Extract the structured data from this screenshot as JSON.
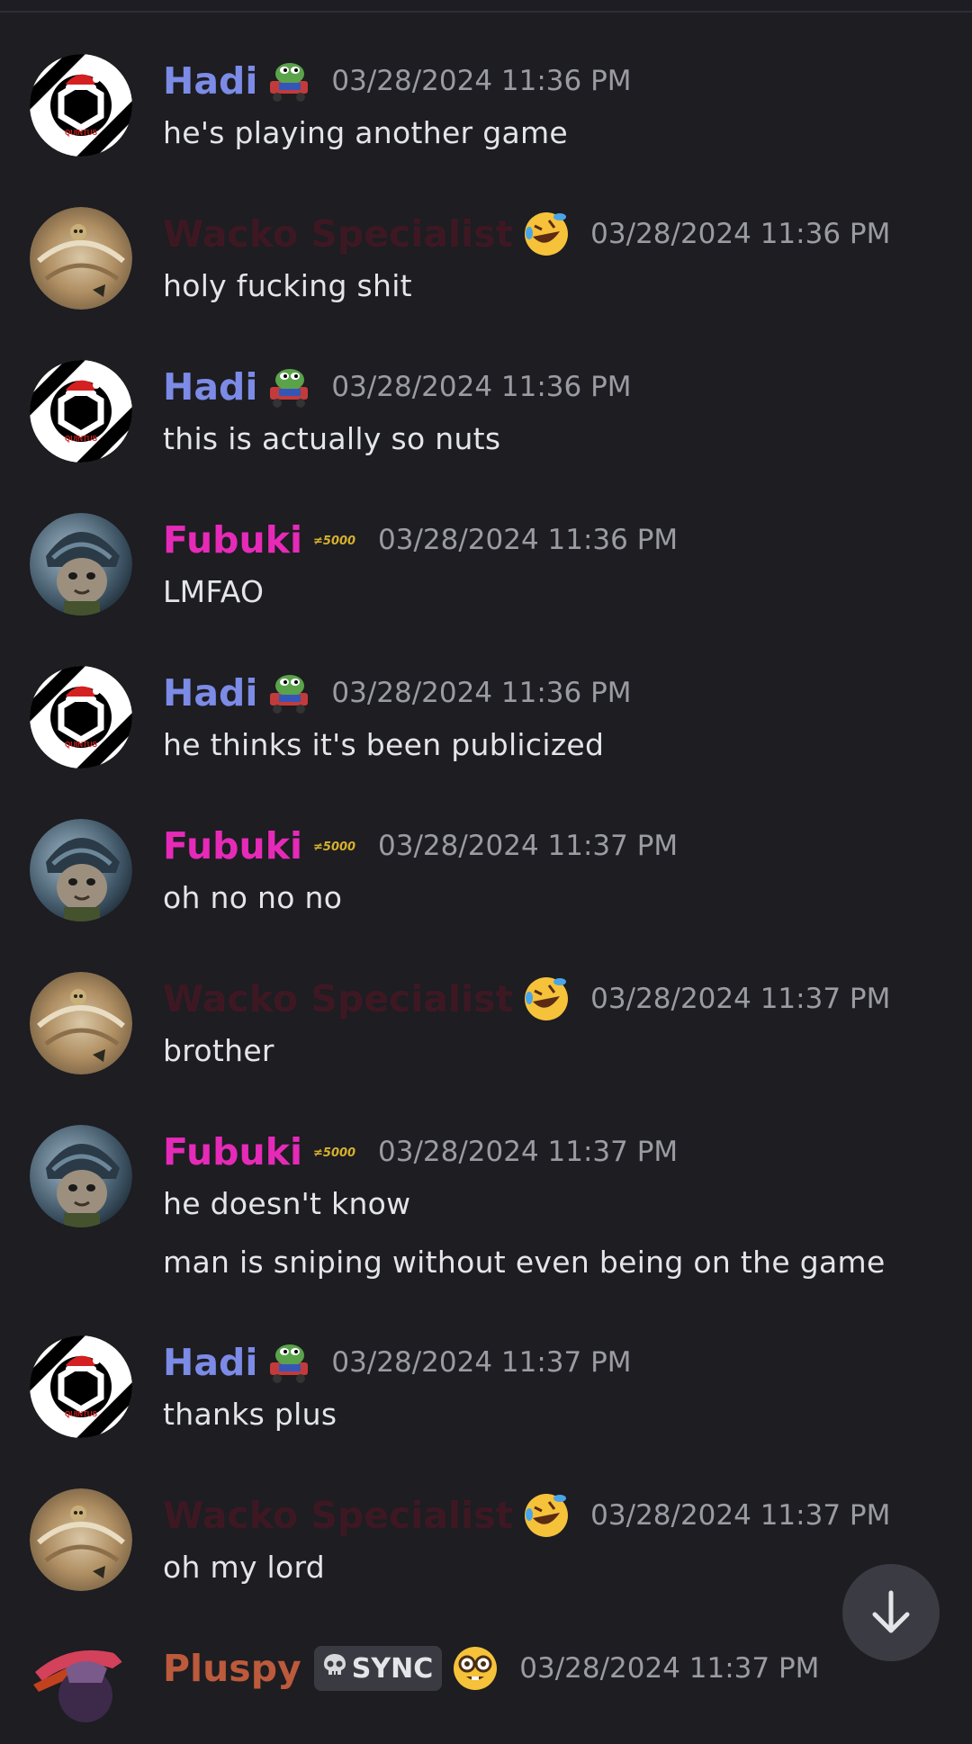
{
  "colors": {
    "background": "#1d1d22",
    "hadi": "#7c8be6",
    "fubuki": "#e62ab8",
    "wacko": "#3d1822",
    "pluspy": "#bc5a3b",
    "timestamp": "#9b9ca3",
    "text": "#e4e5e8"
  },
  "messages": [
    {
      "author": "Hadi",
      "badge": "pepe-cart-emoji",
      "timestamp": "03/28/2024 11:36 PM",
      "lines": [
        "he's playing another game"
      ]
    },
    {
      "author": "Wacko Specialist",
      "badge": "rofl-emoji",
      "timestamp": "03/28/2024 11:36 PM",
      "lines": [
        "holy fucking shit"
      ]
    },
    {
      "author": "Hadi",
      "badge": "pepe-cart-emoji",
      "timestamp": "03/28/2024 11:36 PM",
      "lines": [
        "this is actually so nuts"
      ]
    },
    {
      "author": "Fubuki",
      "badge": "gold-5000-badge",
      "timestamp": "03/28/2024 11:36 PM",
      "lines": [
        "LMFAO"
      ]
    },
    {
      "author": "Hadi",
      "badge": "pepe-cart-emoji",
      "timestamp": "03/28/2024 11:36 PM",
      "lines": [
        "he thinks it's been publicized"
      ]
    },
    {
      "author": "Fubuki",
      "badge": "gold-5000-badge",
      "timestamp": "03/28/2024 11:37 PM",
      "lines": [
        "oh no no no"
      ]
    },
    {
      "author": "Wacko Specialist",
      "badge": "rofl-emoji",
      "timestamp": "03/28/2024 11:37 PM",
      "lines": [
        "brother"
      ]
    },
    {
      "author": "Fubuki",
      "badge": "gold-5000-badge",
      "timestamp": "03/28/2024 11:37 PM",
      "lines": [
        "he doesn't know",
        "man is sniping without even being on the game"
      ]
    },
    {
      "author": "Hadi",
      "badge": "pepe-cart-emoji",
      "timestamp": "03/28/2024 11:37 PM",
      "lines": [
        "thanks plus"
      ]
    },
    {
      "author": "Wacko Specialist",
      "badge": "rofl-emoji",
      "timestamp": "03/28/2024 11:37 PM",
      "lines": [
        "oh my lord"
      ]
    },
    {
      "author": "Pluspy",
      "tag": "SYNC",
      "badge": "nerd-emoji",
      "timestamp": "03/28/2024 11:37 PM",
      "lines": []
    }
  ],
  "scroll_button": {
    "icon": "arrow-down-icon"
  }
}
